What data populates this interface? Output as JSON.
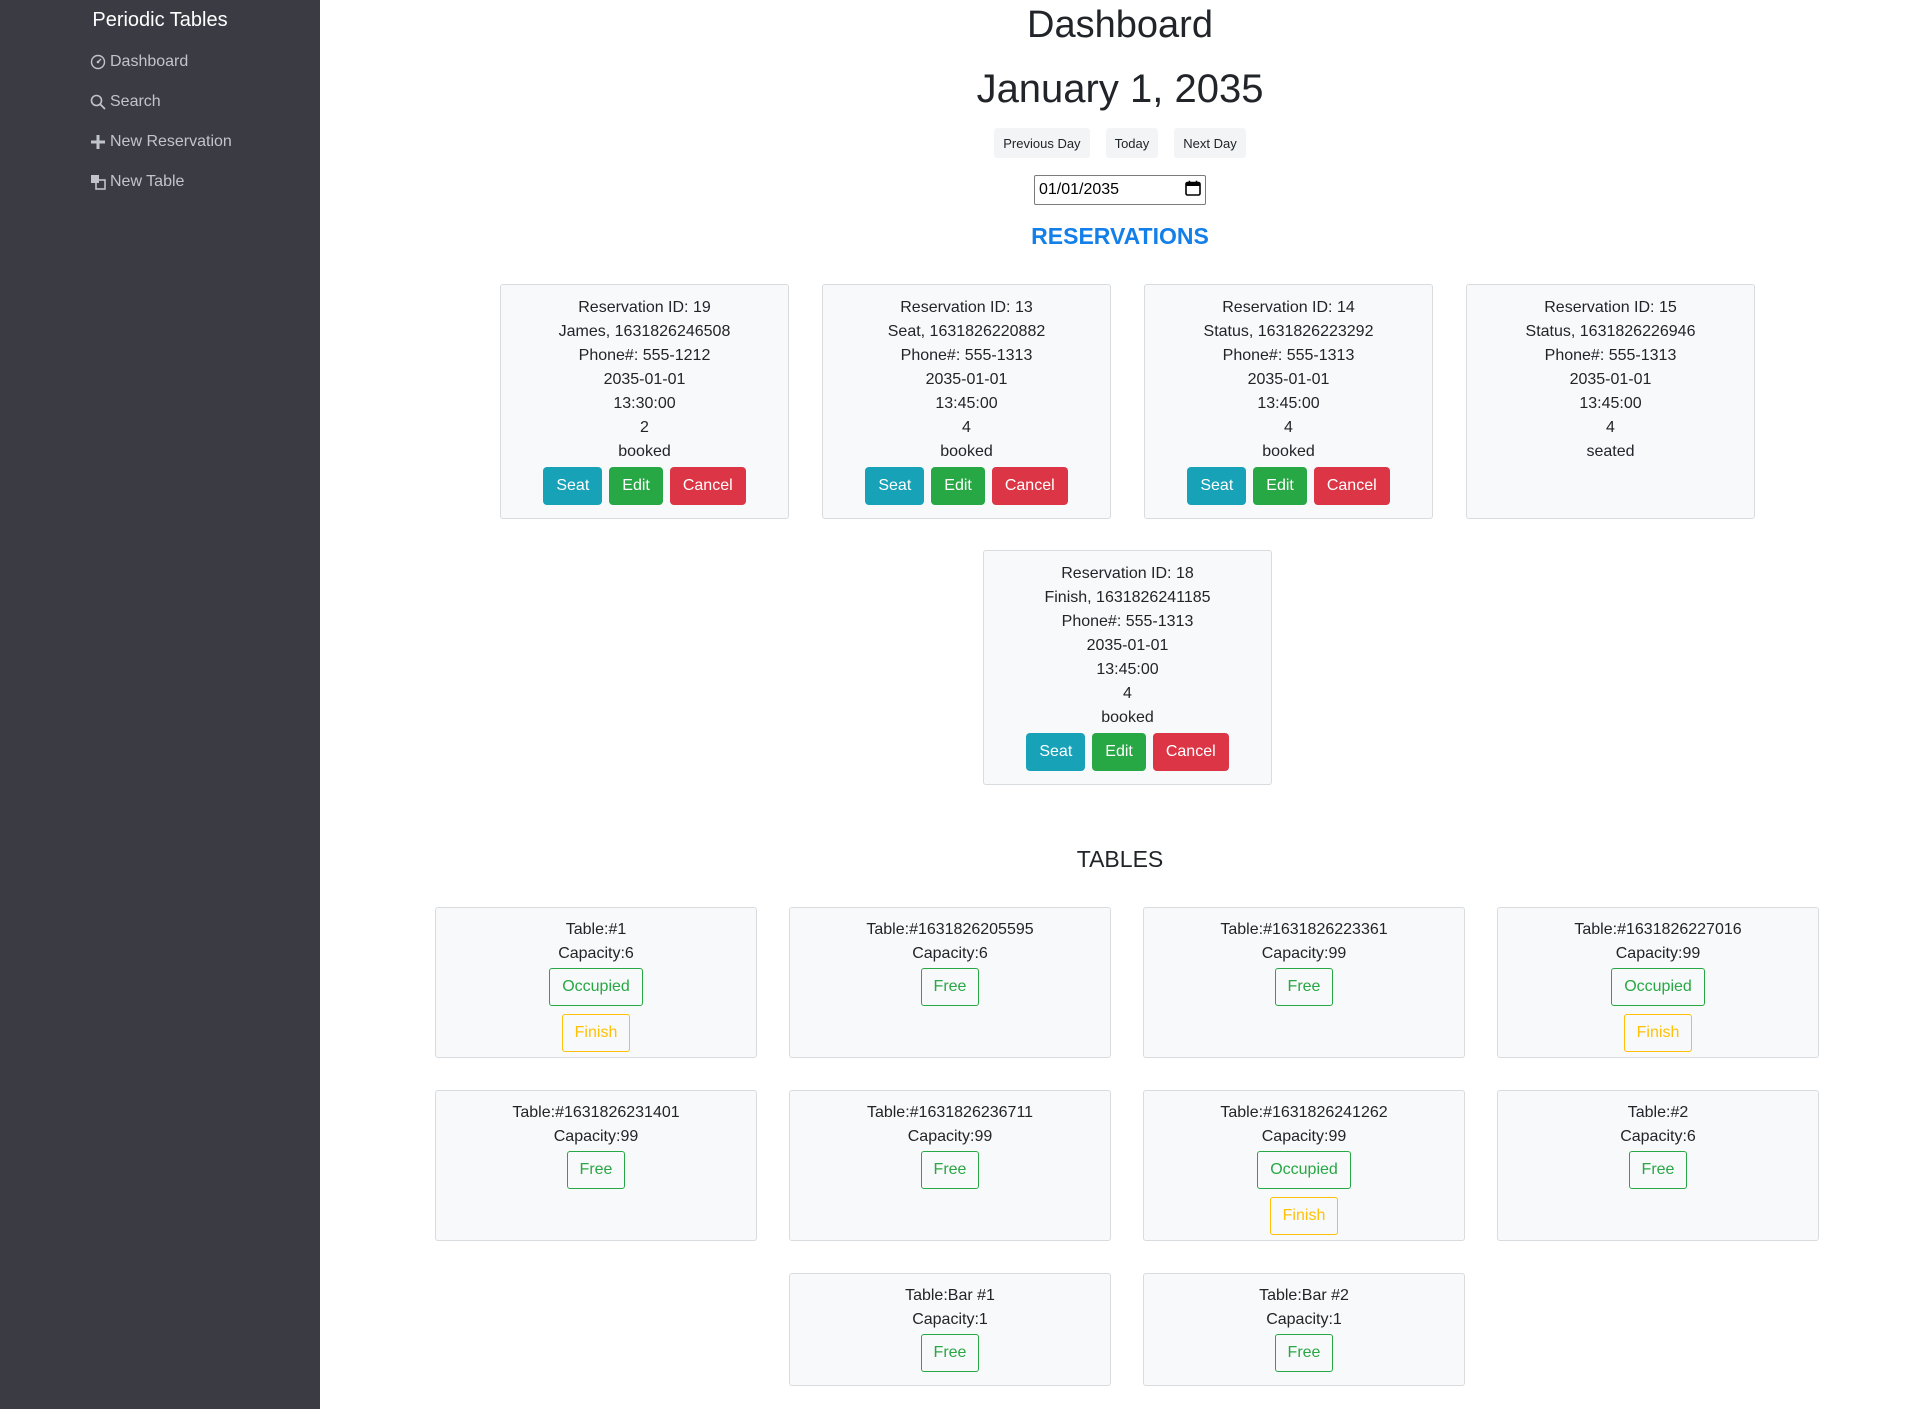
{
  "sidebar": {
    "brand": "Periodic Tables",
    "items": [
      {
        "label": "Dashboard",
        "icon": "dashboard-icon"
      },
      {
        "label": "Search",
        "icon": "search-icon"
      },
      {
        "label": "New Reservation",
        "icon": "plus-icon"
      },
      {
        "label": "New Table",
        "icon": "table-icon"
      }
    ]
  },
  "header": {
    "title": "Dashboard",
    "date": "January 1, 2035",
    "buttons": {
      "previous": "Previous Day",
      "today": "Today",
      "next": "Next Day"
    },
    "date_input": "01/01/2035"
  },
  "reservations": {
    "heading": "RESERVATIONS",
    "id_prefix": "Reservation ID: ",
    "phone_prefix": "Phone#: ",
    "buttons": {
      "seat": "Seat",
      "edit": "Edit",
      "cancel": "Cancel"
    },
    "items": [
      {
        "id": "19",
        "name": "James, 1631826246508",
        "phone": "555-1212",
        "date": "2035-01-01",
        "time": "13:30:00",
        "people": "2",
        "status": "booked"
      },
      {
        "id": "13",
        "name": "Seat, 1631826220882",
        "phone": "555-1313",
        "date": "2035-01-01",
        "time": "13:45:00",
        "people": "4",
        "status": "booked"
      },
      {
        "id": "14",
        "name": "Status, 1631826223292",
        "phone": "555-1313",
        "date": "2035-01-01",
        "time": "13:45:00",
        "people": "4",
        "status": "booked"
      },
      {
        "id": "15",
        "name": "Status, 1631826226946",
        "phone": "555-1313",
        "date": "2035-01-01",
        "time": "13:45:00",
        "people": "4",
        "status": "seated"
      },
      {
        "id": "18",
        "name": "Finish, 1631826241185",
        "phone": "555-1313",
        "date": "2035-01-01",
        "time": "13:45:00",
        "people": "4",
        "status": "booked"
      }
    ]
  },
  "tables": {
    "heading": "TABLES",
    "name_prefix": "Table:",
    "capacity_prefix": "Capacity:",
    "finish_label": "Finish",
    "items": [
      {
        "name": "#1",
        "capacity": "6",
        "status": "Occupied"
      },
      {
        "name": "#1631826205595",
        "capacity": "6",
        "status": "Free"
      },
      {
        "name": "#1631826223361",
        "capacity": "99",
        "status": "Free"
      },
      {
        "name": "#1631826227016",
        "capacity": "99",
        "status": "Occupied"
      },
      {
        "name": "#1631826231401",
        "capacity": "99",
        "status": "Free"
      },
      {
        "name": "#1631826236711",
        "capacity": "99",
        "status": "Free"
      },
      {
        "name": "#1631826241262",
        "capacity": "99",
        "status": "Occupied"
      },
      {
        "name": "#2",
        "capacity": "6",
        "status": "Free"
      },
      {
        "name": "Bar #1",
        "capacity": "1",
        "status": "Free"
      },
      {
        "name": "Bar #2",
        "capacity": "1",
        "status": "Free"
      }
    ]
  },
  "colors": {
    "sidebar_bg": "#3a3b43",
    "reservations_heading": "#137fe8",
    "seat": "#17a2b8",
    "edit": "#28a745",
    "cancel": "#dc3545",
    "free_occupied_outline": "#28a745",
    "finish_outline": "#ffc107"
  }
}
